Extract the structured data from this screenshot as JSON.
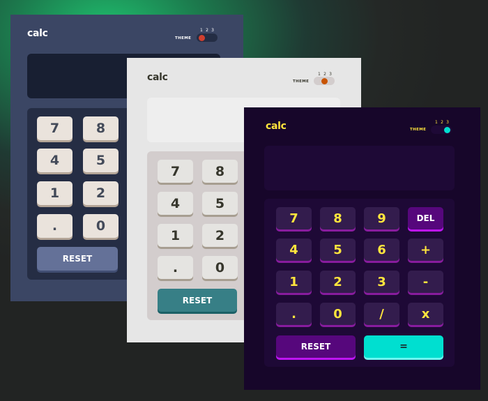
{
  "themes": [
    {
      "id": "theme-1",
      "logo": "calc",
      "theme_label": "THEME",
      "theme_numbers": [
        "1",
        "2",
        "3"
      ],
      "active_theme": 1,
      "keys": [
        "7",
        "8",
        "4",
        "5",
        "1",
        "2",
        ".",
        "0"
      ],
      "reset_label": "RESET",
      "colors": {
        "background": "#3b4664",
        "keypad": "#252d44",
        "key": "#eae3dc",
        "reset": "#647198",
        "toggle_knob": "#d03f2f"
      }
    },
    {
      "id": "theme-2",
      "logo": "calc",
      "theme_label": "THEME",
      "theme_numbers": [
        "1",
        "2",
        "3"
      ],
      "active_theme": 2,
      "keys": [
        "7",
        "8",
        "4",
        "5",
        "1",
        "2",
        ".",
        "0"
      ],
      "reset_label": "RESET",
      "colors": {
        "background": "#e6e6e6",
        "keypad": "#d3cdcd",
        "key": "#e5e4e1",
        "reset": "#377f86",
        "toggle_knob": "#c85402"
      }
    },
    {
      "id": "theme-3",
      "logo": "calc",
      "theme_label": "THEME",
      "theme_numbers": [
        "1",
        "2",
        "3"
      ],
      "active_theme": 3,
      "keys": [
        "7",
        "8",
        "9",
        "DEL",
        "4",
        "5",
        "6",
        "+",
        "1",
        "2",
        "3",
        "-",
        ".",
        "0",
        "/",
        "x"
      ],
      "reset_label": "RESET",
      "equals_label": "=",
      "colors": {
        "background": "#17062a",
        "keypad": "#1e0936",
        "key": "#331c4d",
        "key_text": "#ffe53d",
        "del_reset": "#56077c",
        "equals": "#00dfd0",
        "toggle_knob": "#00dfd0"
      }
    }
  ]
}
